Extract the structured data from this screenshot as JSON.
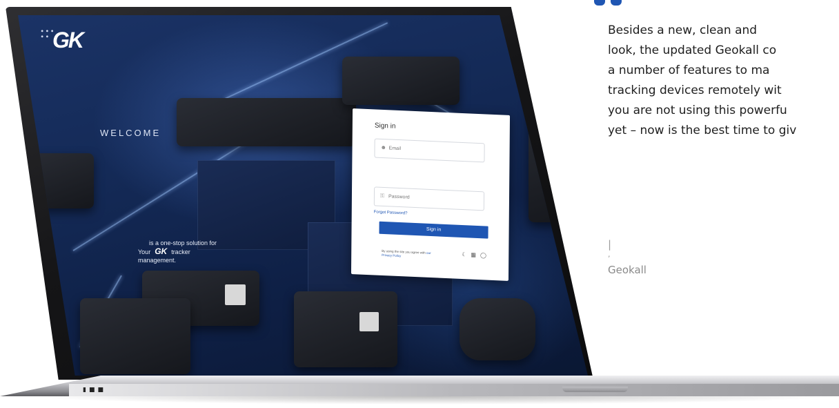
{
  "screen": {
    "brand": "GK",
    "welcome": "WELCOME",
    "tagline": {
      "line1": "is a one-stop solution for",
      "your": "Your",
      "brand_inline": "GK",
      "tracker": "tracker",
      "line3": "management."
    },
    "signin": {
      "title": "Sign in",
      "email_placeholder": "Email",
      "password_placeholder": "Password",
      "forgot": "Forgot Password?",
      "button": "Sign in",
      "legal": "By using the site you agree with",
      "legal_link": "our Privacy Policy"
    }
  },
  "testimonial": {
    "text_lines": [
      "Besides a new, clean and",
      "look, the updated Geokall co",
      "a number of features to ma",
      "tracking devices remotely wit",
      "you are not using this powerfu",
      "yet – now is the best time to giv"
    ],
    "bar": "|",
    "comma": ",",
    "author": "Geokall"
  },
  "colors": {
    "accent": "#1f56b3",
    "screen_bg": "#142a57"
  }
}
